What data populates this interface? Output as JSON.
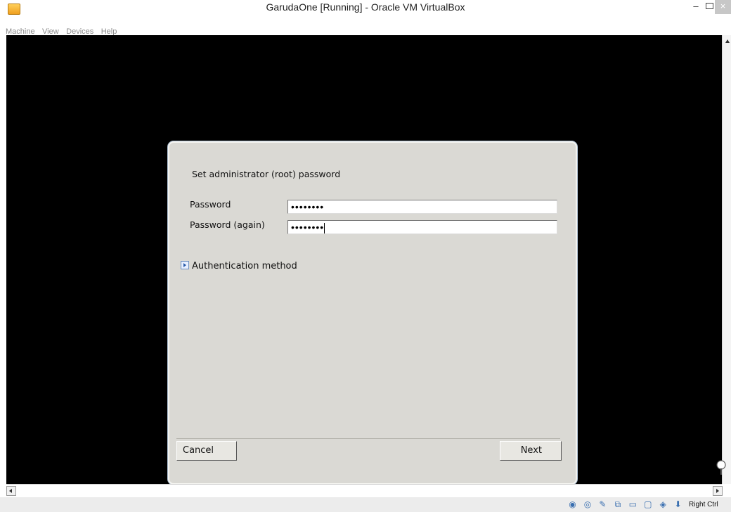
{
  "window": {
    "title": "GarudaOne [Running] - Oracle VM VirtualBox",
    "minimize_glyph": "–",
    "close_glyph": "×"
  },
  "menu": [
    "Machine",
    "View",
    "Devices",
    "Help"
  ],
  "dialog": {
    "heading": "Set administrator (root) password",
    "password_label": "Password",
    "password_value": "••••••••",
    "password_again_label": "Password (again)",
    "password_again_value": "••••••••",
    "expander_label": "Authentication method",
    "cancel_label": "Cancel",
    "next_label": "Next"
  },
  "statusbar": {
    "icons": [
      "hard-disk-icon",
      "optical-drive-icon",
      "usb-icon",
      "network-icon",
      "shared-folders-icon",
      "display-icon",
      "video-capture-icon",
      "mouse-integration-icon"
    ],
    "host_key": "Right Ctrl"
  },
  "colors": {
    "vm_background": "#000000",
    "dialog_background": "#dad9d4"
  }
}
